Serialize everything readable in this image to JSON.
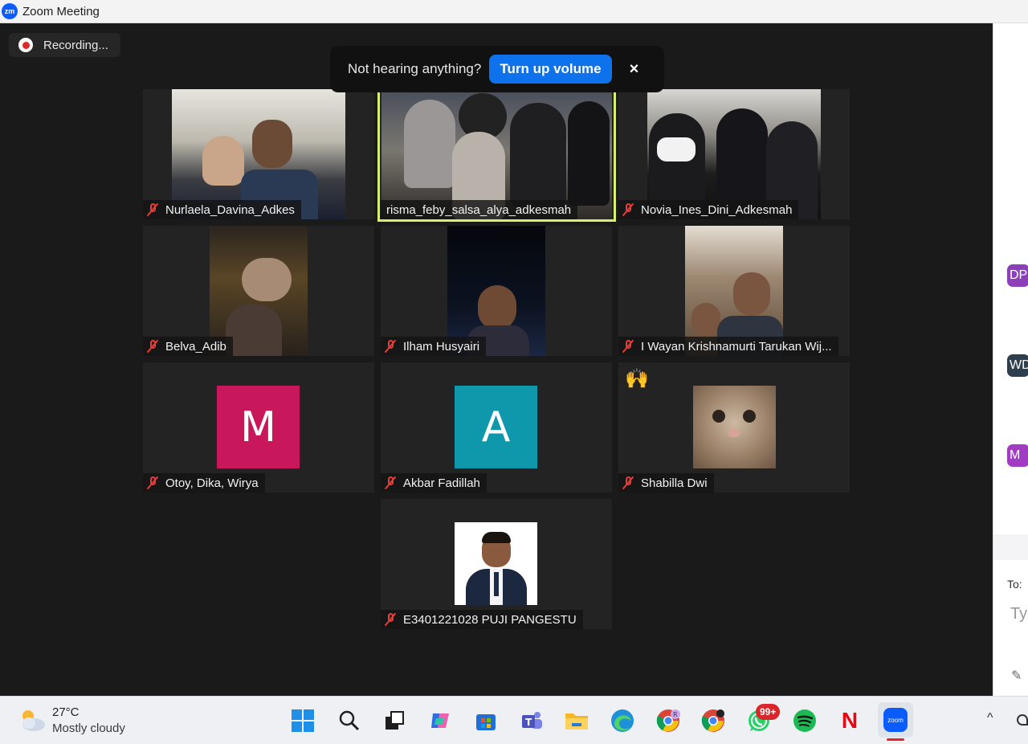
{
  "window": {
    "title": "Zoom Meeting",
    "logo_text": "zm"
  },
  "recording": {
    "label": "Recording..."
  },
  "volume_toast": {
    "text": "Not hearing anything?",
    "button": "Turn up volume",
    "close": "×"
  },
  "participants": [
    {
      "name": "Nurlaela_Davina_Adkes"
    },
    {
      "name": "risma_feby_salsa_alya_adkesmah"
    },
    {
      "name": "Novia_Ines_Dini_Adkesmah"
    },
    {
      "name": "Belva_Adib"
    },
    {
      "name": "Ilham Husyairi"
    },
    {
      "name": "I Wayan Krishnamurti Tarukan Wij..."
    },
    {
      "name": "Otoy, Dika, Wirya",
      "avatar_letter": "M",
      "avatar_color": "#c8175a"
    },
    {
      "name": "Akbar Fadillah",
      "avatar_letter": "A",
      "avatar_color": "#0f98ab"
    },
    {
      "name": "Shabilla Dwi",
      "reaction": "🙌"
    },
    {
      "name": "E3401221028 PUJI PANGESTU"
    }
  ],
  "side_panel": {
    "avatars": [
      {
        "initials": "DP",
        "color": "#8c3fb8"
      },
      {
        "initials": "WD",
        "color": "#2f3e4e"
      },
      {
        "initials": "M",
        "color": "#a13bc4"
      }
    ],
    "to_label": "To:",
    "message_placeholder": "Typ"
  },
  "taskbar": {
    "weather": {
      "temp": "27°C",
      "desc": "Mostly cloudy"
    },
    "whatsapp_badge": "99+",
    "apps": [
      "start-icon",
      "search-icon",
      "task-view-icon",
      "copilot-icon",
      "store-icon",
      "teams-icon",
      "file-explorer-icon",
      "edge-icon",
      "chrome-profile-icon",
      "chrome-icon",
      "whatsapp-icon",
      "spotify-icon",
      "netflix-icon",
      "zoom-icon"
    ],
    "netflix_letter": "N",
    "zoom_text": "zoom"
  }
}
